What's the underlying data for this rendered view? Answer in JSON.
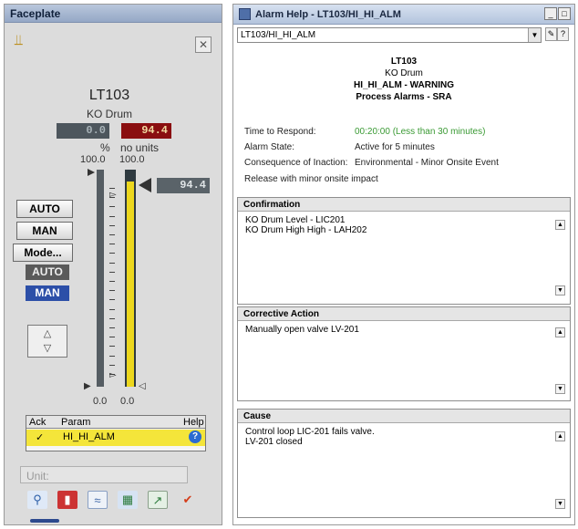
{
  "faceplate": {
    "title": "Faceplate",
    "tag": "LT103",
    "description": "KO Drum",
    "pv_value": "0.0",
    "sp_value": "94.4",
    "pv_unit": "%",
    "sp_unit": "no units",
    "pv_scale_max": "100.0",
    "sp_scale_max": "100.0",
    "pv_scale_min": "0.0",
    "sp_scale_min": "0.0",
    "setpoint_label": "94.4",
    "sp_fill_fraction": 0.944,
    "mode_buttons": [
      "AUTO",
      "MAN",
      "Mode..."
    ],
    "mode_indicators": {
      "auto": "AUTO",
      "man": "MAN"
    },
    "alarm_table": {
      "headers": {
        "ack": "Ack",
        "param": "Param",
        "help": "Help"
      },
      "row": {
        "ack": "✓",
        "param": "HI_HI_ALM",
        "help": "?"
      }
    },
    "unit_field": "Unit:",
    "toolbar_icons": [
      "search-icon",
      "notebook-icon",
      "trend-icon",
      "tuning-icon",
      "chart-icon",
      "check-pencil-icon"
    ]
  },
  "alarm_help": {
    "window_title": "Alarm Help - LT103/HI_HI_ALM",
    "combo_value": "LT103/HI_HI_ALM",
    "header": {
      "tag": "LT103",
      "description": "KO Drum",
      "alarm": "HI_HI_ALM - WARNING",
      "category": "Process Alarms - SRA"
    },
    "info": {
      "time_label": "Time to Respond:",
      "time_value": "00:20:00 (Less than 30 minutes)",
      "state_label": "Alarm State:",
      "state_value": "Active for 5 minutes",
      "consequence_label": "Consequence of Inaction:",
      "consequence_value": "Environmental - Minor Onsite Event",
      "release": "Release with minor onsite impact"
    },
    "sections": {
      "confirmation": {
        "title": "Confirmation",
        "line1": "KO Drum Level - LIC201",
        "line2": "KO Drum High High - LAH202"
      },
      "corrective": {
        "title": "Corrective Action",
        "line1": "Manually open valve LV-201"
      },
      "cause": {
        "title": "Cause",
        "line1": "Control loop LIC-201 fails valve.",
        "line2": "LV-201 closed"
      }
    },
    "colors": {
      "time_value": "#3a9a34"
    }
  }
}
